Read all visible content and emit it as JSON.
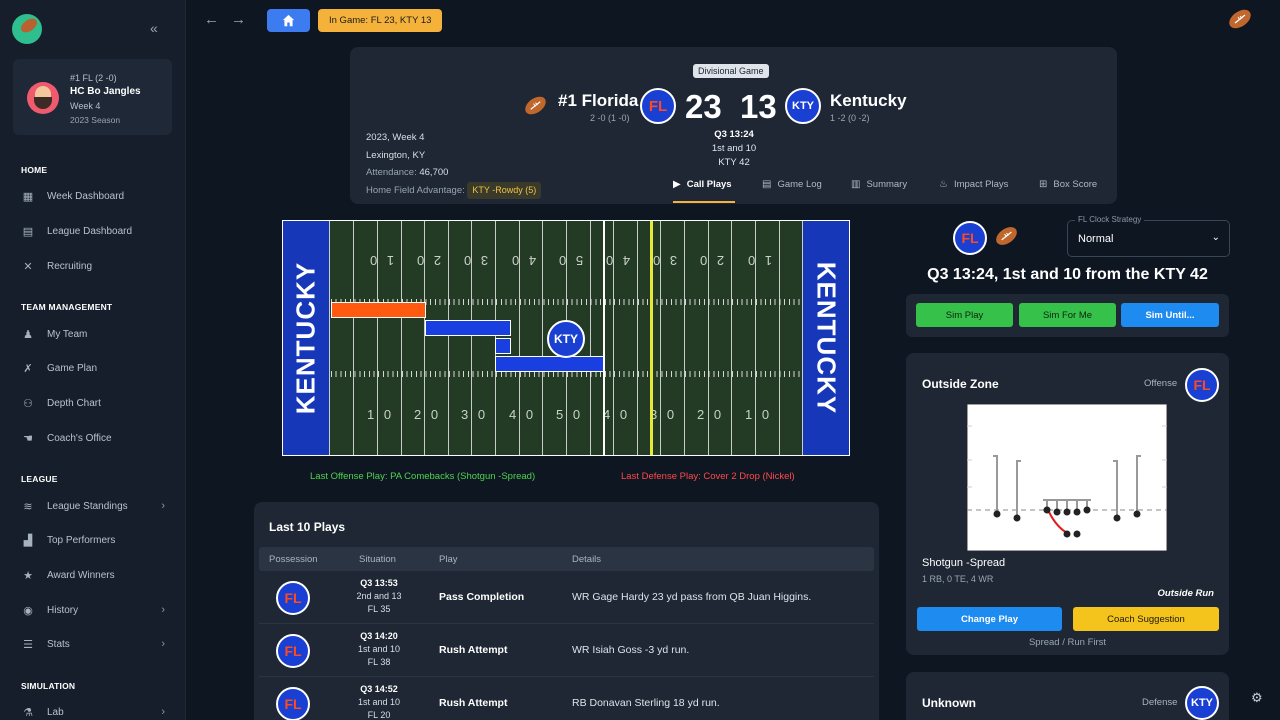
{
  "sidebar": {
    "coach": {
      "rank_line": "#1 FL (2 -0)",
      "name": "HC Bo Jangles",
      "week": "Week 4",
      "season": "2023 Season"
    },
    "sections": {
      "home": "HOME",
      "team": "TEAM MANAGEMENT",
      "league": "LEAGUE",
      "simulation": "SIMULATION"
    },
    "items": {
      "week_dashboard": "Week Dashboard",
      "league_dashboard": "League Dashboard",
      "recruiting": "Recruiting",
      "my_team": "My Team",
      "game_plan": "Game Plan",
      "depth_chart": "Depth Chart",
      "coachs_office": "Coach's Office",
      "league_standings": "League Standings",
      "top_performers": "Top Performers",
      "award_winners": "Award Winners",
      "history": "History",
      "stats": "Stats",
      "lab": "Lab"
    }
  },
  "topbar": {
    "in_game": "In Game: FL 23, KTY 13"
  },
  "scoreboard": {
    "badge": "Divisional Game",
    "home": {
      "name": "#1 Florida",
      "record": "2 -0 (1 -0)",
      "abbr": "FL",
      "score": "23"
    },
    "away": {
      "name": "Kentucky",
      "record": "1 -2 (0 -2)",
      "abbr": "KTY",
      "score": "13"
    },
    "clock": {
      "time": "Q3 13:24",
      "down": "1st and 10",
      "spot": "KTY 42"
    },
    "info": {
      "week": "2023, Week 4",
      "location": "Lexington, KY",
      "attendance_label": "Attendance:",
      "attendance_value": "46,700",
      "hfa_label": "Home Field Advantage:",
      "hfa_value": "KTY -Rowdy (5)"
    },
    "tabs": [
      "Call Plays",
      "Game Log",
      "Summary",
      "Impact Plays",
      "Box Score"
    ]
  },
  "field": {
    "endzone_left": "KENTUCKY",
    "endzone_right": "KENTUCKY",
    "top_numbers": [
      "1 0",
      "2 0",
      "3 0",
      "4 0",
      "5 0",
      "4 0",
      "3 0",
      "2 0",
      "1 0"
    ],
    "bottom_numbers": [
      "1 0",
      "2 0",
      "3 0",
      "4 0",
      "5 0",
      "4 0",
      "3 0",
      "2 0",
      "1 0"
    ],
    "marker": "KTY",
    "last_offense": "Last Offense Play: PA Comebacks (Shotgun -Spread)",
    "last_defense": "Last Defense Play: Cover 2 Drop (Nickel)",
    "colors": {
      "offense_drive": "#ff5a10",
      "defense_drive": "#1a3fe0",
      "first_down_line": "#e8e83a"
    }
  },
  "plays": {
    "title": "Last 10 Plays",
    "headers": [
      "Possession",
      "Situation",
      "Play",
      "Details"
    ],
    "rows": [
      {
        "team": "FL",
        "time": "Q3 13:53",
        "down": "2nd and 13",
        "spot": "FL 35",
        "play": "Pass Completion",
        "details": "WR Gage Hardy 23 yd pass from QB Juan Higgins."
      },
      {
        "team": "FL",
        "time": "Q3 14:20",
        "down": "1st and 10",
        "spot": "FL 38",
        "play": "Rush Attempt",
        "details": "WR Isiah Goss -3 yd run."
      },
      {
        "team": "FL",
        "time": "Q3 14:52",
        "down": "1st and 10",
        "spot": "FL 20",
        "play": "Rush Attempt",
        "details": "RB Donavan Sterling 18 yd run."
      }
    ]
  },
  "right_panel": {
    "team_abbr": "FL",
    "clock_strategy_label": "FL Clock Strategy",
    "clock_strategy_value": "Normal",
    "situation": "Q3 13:24, 1st and 10 from the KTY 42",
    "sim_buttons": [
      "Sim Play",
      "Sim For Me",
      "Sim Until..."
    ],
    "offense": {
      "play_name": "Outside Zone",
      "side": "Offense",
      "team": "FL",
      "formation": "Shotgun -Spread",
      "personnel": "1 RB, 0 TE, 4 WR",
      "play_type": "Outside Run",
      "change_play": "Change Play",
      "coach_suggestion": "Coach Suggestion",
      "strategy": "Spread / Run First"
    },
    "defense": {
      "play_name": "Unknown",
      "side": "Defense",
      "team": "KTY"
    }
  }
}
